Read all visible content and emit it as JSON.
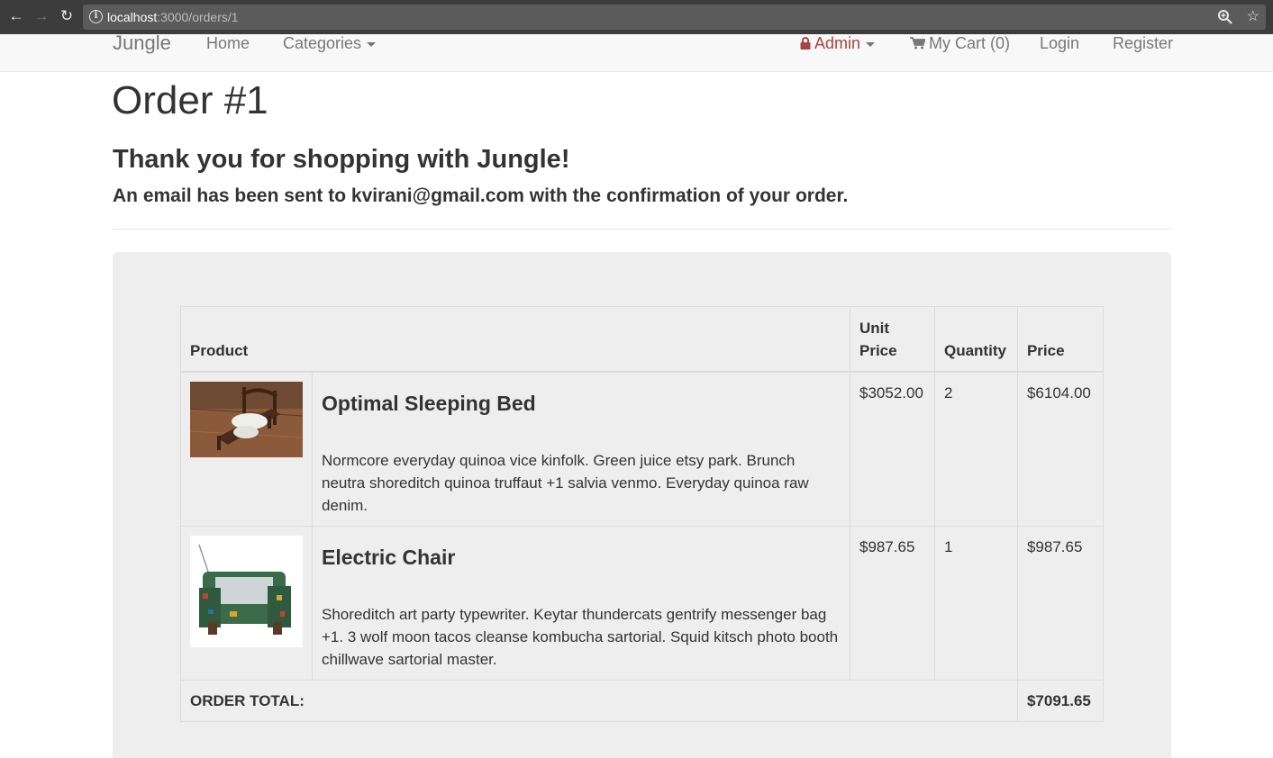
{
  "browser": {
    "url_host": "localhost",
    "url_path": ":3000/orders/1"
  },
  "navbar": {
    "brand": "Jungle",
    "home": "Home",
    "categories": "Categories",
    "admin": "Admin",
    "cart": "My Cart (0)",
    "login": "Login",
    "register": "Register",
    "admin_color": "#a94442"
  },
  "page": {
    "title": "Order #1",
    "thanks": "Thank you for shopping with Jungle!",
    "email_notice": "An email has been sent to kvirani@gmail.com with the confirmation of your order."
  },
  "table": {
    "headers": {
      "product": "Product",
      "unit_price": "Unit Price",
      "quantity": "Quantity",
      "price": "Price"
    },
    "rows": [
      {
        "name": "Optimal Sleeping Bed",
        "description": "Normcore everyday quinoa vice kinfolk. Green juice etsy park. Brunch neutra shoreditch quinoa truffaut +1 salvia venmo. Everyday quinoa raw denim.",
        "unit_price": "$3052.00",
        "quantity": "2",
        "price": "$6104.00"
      },
      {
        "name": "Electric Chair",
        "description": "Shoreditch art party typewriter. Keytar thundercats gentrify messenger bag +1. 3 wolf moon tacos cleanse kombucha sartorial. Squid kitsch photo booth chillwave sartorial master.",
        "unit_price": "$987.65",
        "quantity": "1",
        "price": "$987.65"
      }
    ],
    "total_label": "ORDER TOTAL:",
    "total_value": "$7091.65"
  }
}
